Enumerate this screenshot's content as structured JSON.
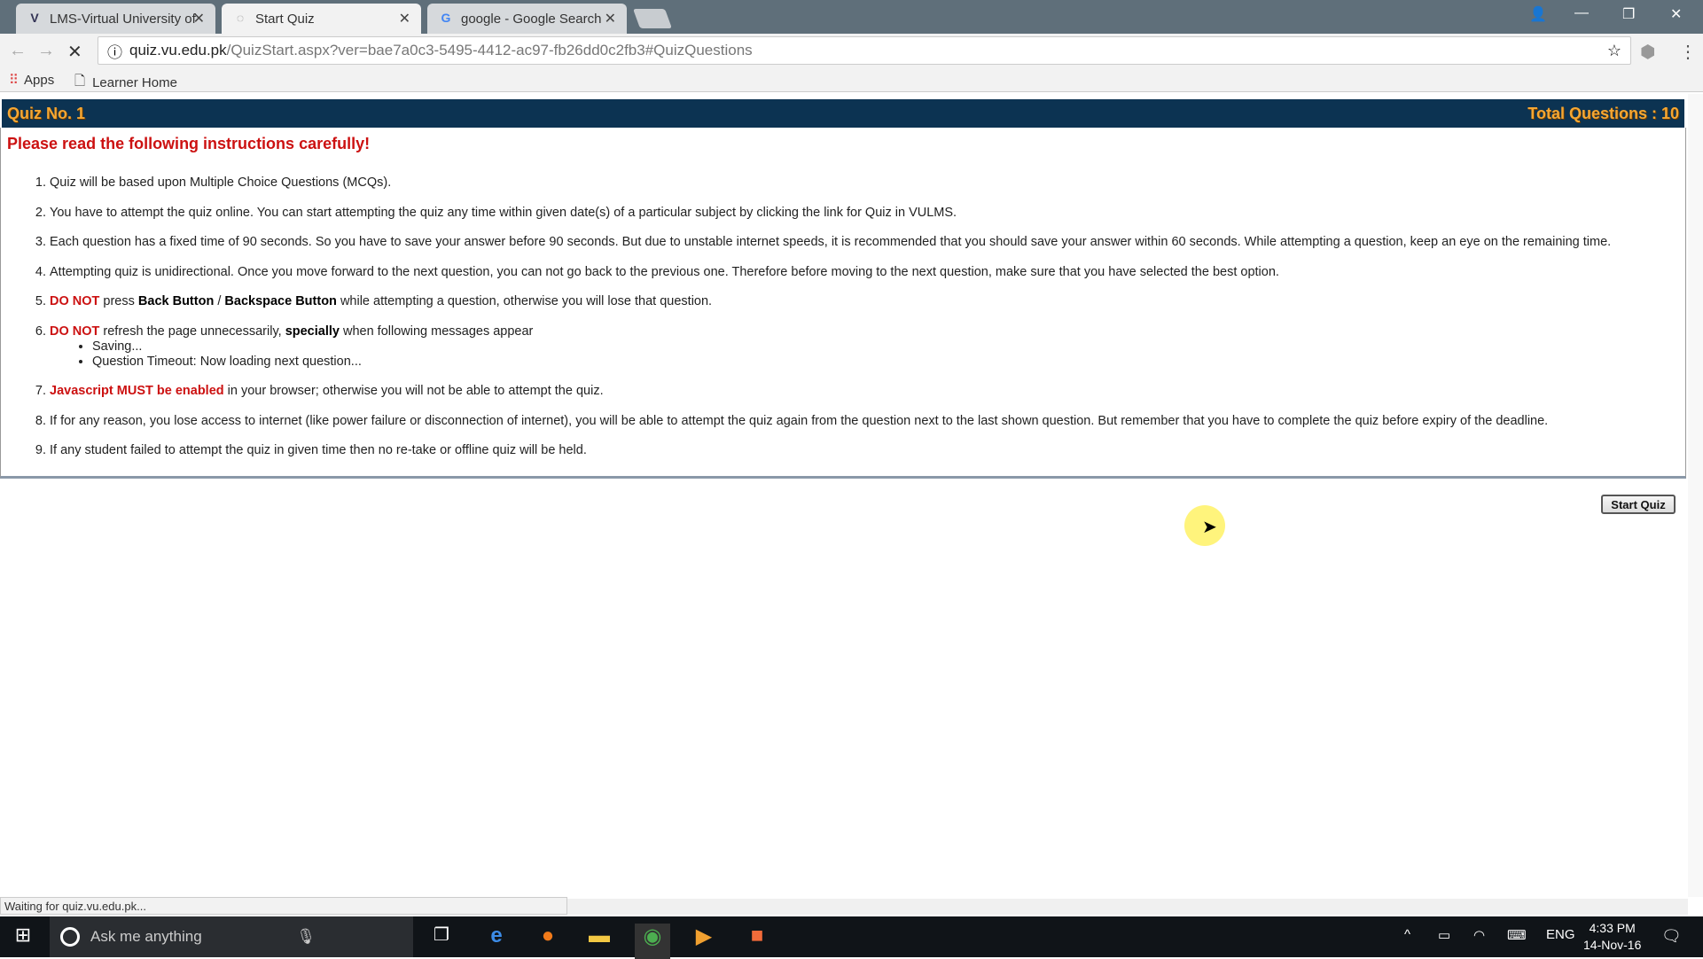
{
  "browser": {
    "tabs": [
      {
        "label": "LMS-Virtual University of",
        "icon": "lms-favicon"
      },
      {
        "label": "Start Quiz",
        "icon": "loading-spinner-icon"
      },
      {
        "label": "google - Google Search",
        "icon": "google-favicon"
      }
    ],
    "url_host": "quiz.vu.edu.pk",
    "url_path": "/QuizStart.aspx?ver=bae7a0c3-5495-4412-ac97-fb26dd0c2fb3#QuizQuestions",
    "bookmarks": [
      "Apps",
      "Learner Home"
    ],
    "status_text": "Waiting for quiz.vu.edu.pk..."
  },
  "quiz": {
    "title": "Quiz No. 1",
    "total_questions": "Total Questions : 10",
    "intro": "Please read the following instructions carefully!",
    "items": [
      {
        "text": "Quiz will be based upon Multiple Choice Questions (MCQs)."
      },
      {
        "text": "You have to attempt the quiz online. You can start attempting the quiz any time within given date(s) of a particular subject by clicking the link for Quiz in VULMS."
      },
      {
        "text": "Each question has a fixed time of 90 seconds. So you have to save your answer before 90 seconds. But due to unstable internet speeds, it is recommended that you should save your answer within 60 seconds. While attempting a question, keep an eye on the remaining time."
      },
      {
        "text": "Attempting quiz is unidirectional. Once you move forward to the next question, you can not go back to the previous one. Therefore before moving to the next question, make sure that you have selected the best option."
      },
      {
        "red": "DO NOT",
        "t1": " press ",
        "b1": "Back Button",
        "t2": " / ",
        "b2": "Backspace Button",
        "t3": " while attempting a question, otherwise you will lose that question."
      },
      {
        "red": "DO NOT",
        "t1": " refresh the page unnecessarily, ",
        "b1": "specially",
        "t2": " when following messages appear",
        "sub": [
          "Saving...",
          "Question Timeout: Now loading next question..."
        ]
      },
      {
        "red": "Javascript MUST be enabled",
        "t1": " in your browser; otherwise you will not be able to attempt the quiz."
      },
      {
        "text": "If for any reason, you lose access to internet (like power failure or disconnection of internet), you will be able to attempt the quiz again from the question next to the last shown question. But remember that you have to complete the quiz before expiry of the deadline."
      },
      {
        "text": "If any student failed to attempt the quiz in given time then no re-take or offline quiz will be held."
      }
    ],
    "start_button": "Start Quiz"
  },
  "colors": {
    "header_bg": "#0c3352",
    "header_text": "#f5a733",
    "warning_red": "#cc1111"
  },
  "taskbar": {
    "search_placeholder": "Ask me anything",
    "lang": "ENG",
    "time": "4:33 PM",
    "date": "14-Nov-16"
  }
}
